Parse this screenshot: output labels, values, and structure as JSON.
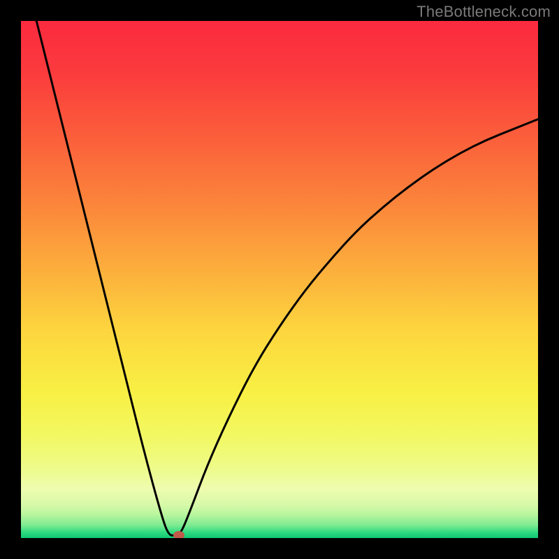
{
  "attribution": "TheBottleneck.com",
  "chart_data": {
    "type": "line",
    "title": "",
    "xlabel": "",
    "ylabel": "",
    "xlim": [
      0,
      100
    ],
    "ylim": [
      0,
      100
    ],
    "series": [
      {
        "name": "bottleneck-curve",
        "x": [
          3,
          6,
          9,
          12,
          15,
          18,
          21,
          24,
          27,
          28.5,
          30,
          31,
          33,
          36,
          40,
          45,
          50,
          55,
          60,
          65,
          70,
          75,
          80,
          85,
          90,
          95,
          100
        ],
        "values": [
          100,
          88,
          76,
          64,
          52,
          40,
          28,
          16,
          5,
          0.5,
          0.5,
          1,
          6,
          14,
          23,
          33,
          41,
          48,
          54,
          59.5,
          64,
          68,
          71.5,
          74.5,
          77,
          79,
          81
        ]
      }
    ],
    "marker": {
      "x": 30.5,
      "y": 0.5,
      "color": "#c05a4a"
    },
    "gradient_stops": [
      {
        "offset": 0.0,
        "color": "#fb2a3f"
      },
      {
        "offset": 0.1,
        "color": "#fb3b3d"
      },
      {
        "offset": 0.22,
        "color": "#fb5d3b"
      },
      {
        "offset": 0.35,
        "color": "#fb843b"
      },
      {
        "offset": 0.48,
        "color": "#fcae3c"
      },
      {
        "offset": 0.6,
        "color": "#fdd63e"
      },
      {
        "offset": 0.72,
        "color": "#f8f044"
      },
      {
        "offset": 0.8,
        "color": "#f2f861"
      },
      {
        "offset": 0.86,
        "color": "#eefb86"
      },
      {
        "offset": 0.905,
        "color": "#eefcb0"
      },
      {
        "offset": 0.935,
        "color": "#d8f9a8"
      },
      {
        "offset": 0.955,
        "color": "#b8f59e"
      },
      {
        "offset": 0.975,
        "color": "#7eeb92"
      },
      {
        "offset": 0.99,
        "color": "#2ad97f"
      },
      {
        "offset": 1.0,
        "color": "#0fc873"
      }
    ]
  }
}
